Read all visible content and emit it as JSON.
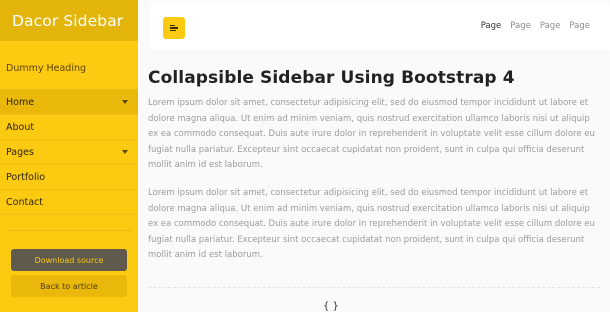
{
  "sidebar": {
    "brand": "Dacor Sidebar",
    "heading": "Dummy Heading",
    "items": [
      {
        "label": "Home",
        "has_caret": true,
        "active": true
      },
      {
        "label": "About",
        "has_caret": false
      },
      {
        "label": "Pages",
        "has_caret": true
      },
      {
        "label": "Portfolio",
        "has_caret": false
      },
      {
        "label": "Contact",
        "has_caret": false
      }
    ],
    "download_label": "Download source",
    "back_label": "Back to article"
  },
  "topbar": {
    "toggle_icon": "hamburger-icon",
    "links": [
      "Page",
      "Page",
      "Page",
      "Page"
    ]
  },
  "main": {
    "title": "Collapsible Sidebar Using Bootstrap 4",
    "paragraphs": [
      "Lorem ipsum dolor sit amet, consectetur adipisicing elit, sed do eiusmod tempor incididunt ut labore et dolore magna aliqua. Ut enim ad minim veniam, quis nostrud exercitation ullamco laboris nisi ut aliquip ex ea commodo consequat. Duis aute irure dolor in reprehenderit in voluptate velit esse cillum dolore eu fugiat nulla pariatur. Excepteur sint occaecat cupidatat non proident, sunt in culpa qui officia deserunt mollit anim id est laborum.",
      "Lorem ipsum dolor sit amet, consectetur adipisicing elit, sed do eiusmod tempor incididunt ut labore et dolore magna aliqua. Ut enim ad minim veniam, quis nostrud exercitation ullamco laboris nisi ut aliquip ex ea commodo consequat. Duis aute irure dolor in reprehenderit in voluptate velit esse cillum dolore eu fugiat nulla pariatur. Excepteur sint occaecat cupidatat non proident, sunt in culpa qui officia deserunt mollit anim id est laborum."
    ],
    "bottom_glyph": "{ }"
  },
  "colors": {
    "accent": "#fdca12",
    "accent_dark": "#e3b40a",
    "button_dark": "#5f5a4b"
  }
}
